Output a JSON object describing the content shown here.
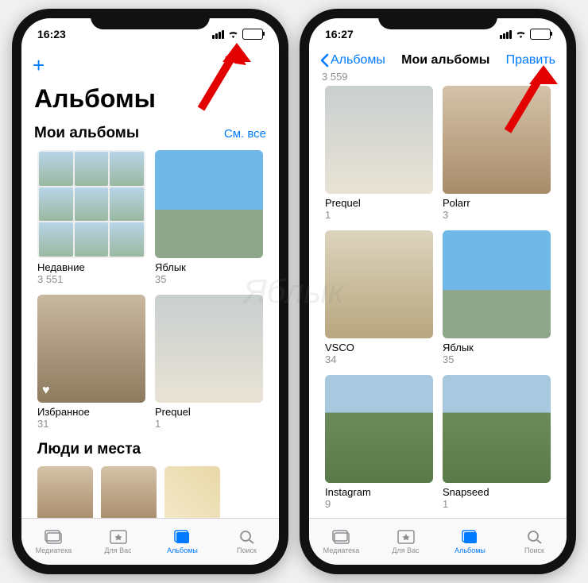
{
  "left": {
    "time": "16:23",
    "plus": "+",
    "large_title": "Альбомы",
    "section1": {
      "title": "Мои альбомы",
      "see_all": "См. все"
    },
    "albums": [
      {
        "name": "Недавние",
        "count": "3 551",
        "style": "collage"
      },
      {
        "name": "Яблык",
        "count": "35",
        "style": "img-sky"
      },
      {
        "name": "Избранное",
        "count": "31",
        "style": "img-indoor",
        "fav": true
      },
      {
        "name": "Prequel",
        "count": "1",
        "style": "img-white"
      }
    ],
    "section2": {
      "title": "Люди и места"
    }
  },
  "right": {
    "time": "16:27",
    "back": "Альбомы",
    "title": "Мои альбомы",
    "action": "Править",
    "top_count": "3 559",
    "albums": [
      {
        "name": "Prequel",
        "count": "1",
        "style": "img-white"
      },
      {
        "name": "Polarr",
        "count": "3",
        "style": "img-person"
      },
      {
        "name": "VSCO",
        "count": "34",
        "style": "img-arch"
      },
      {
        "name": "Яблык",
        "count": "35",
        "style": "img-sky"
      },
      {
        "name": "Instagram",
        "count": "9",
        "style": "img-mount"
      },
      {
        "name": "Snapseed",
        "count": "1",
        "style": "img-mount"
      }
    ]
  },
  "tabs": [
    {
      "label": "Медиатека"
    },
    {
      "label": "Для Вас"
    },
    {
      "label": "Альбомы"
    },
    {
      "label": "Поиск"
    }
  ],
  "watermark": "Яблык"
}
